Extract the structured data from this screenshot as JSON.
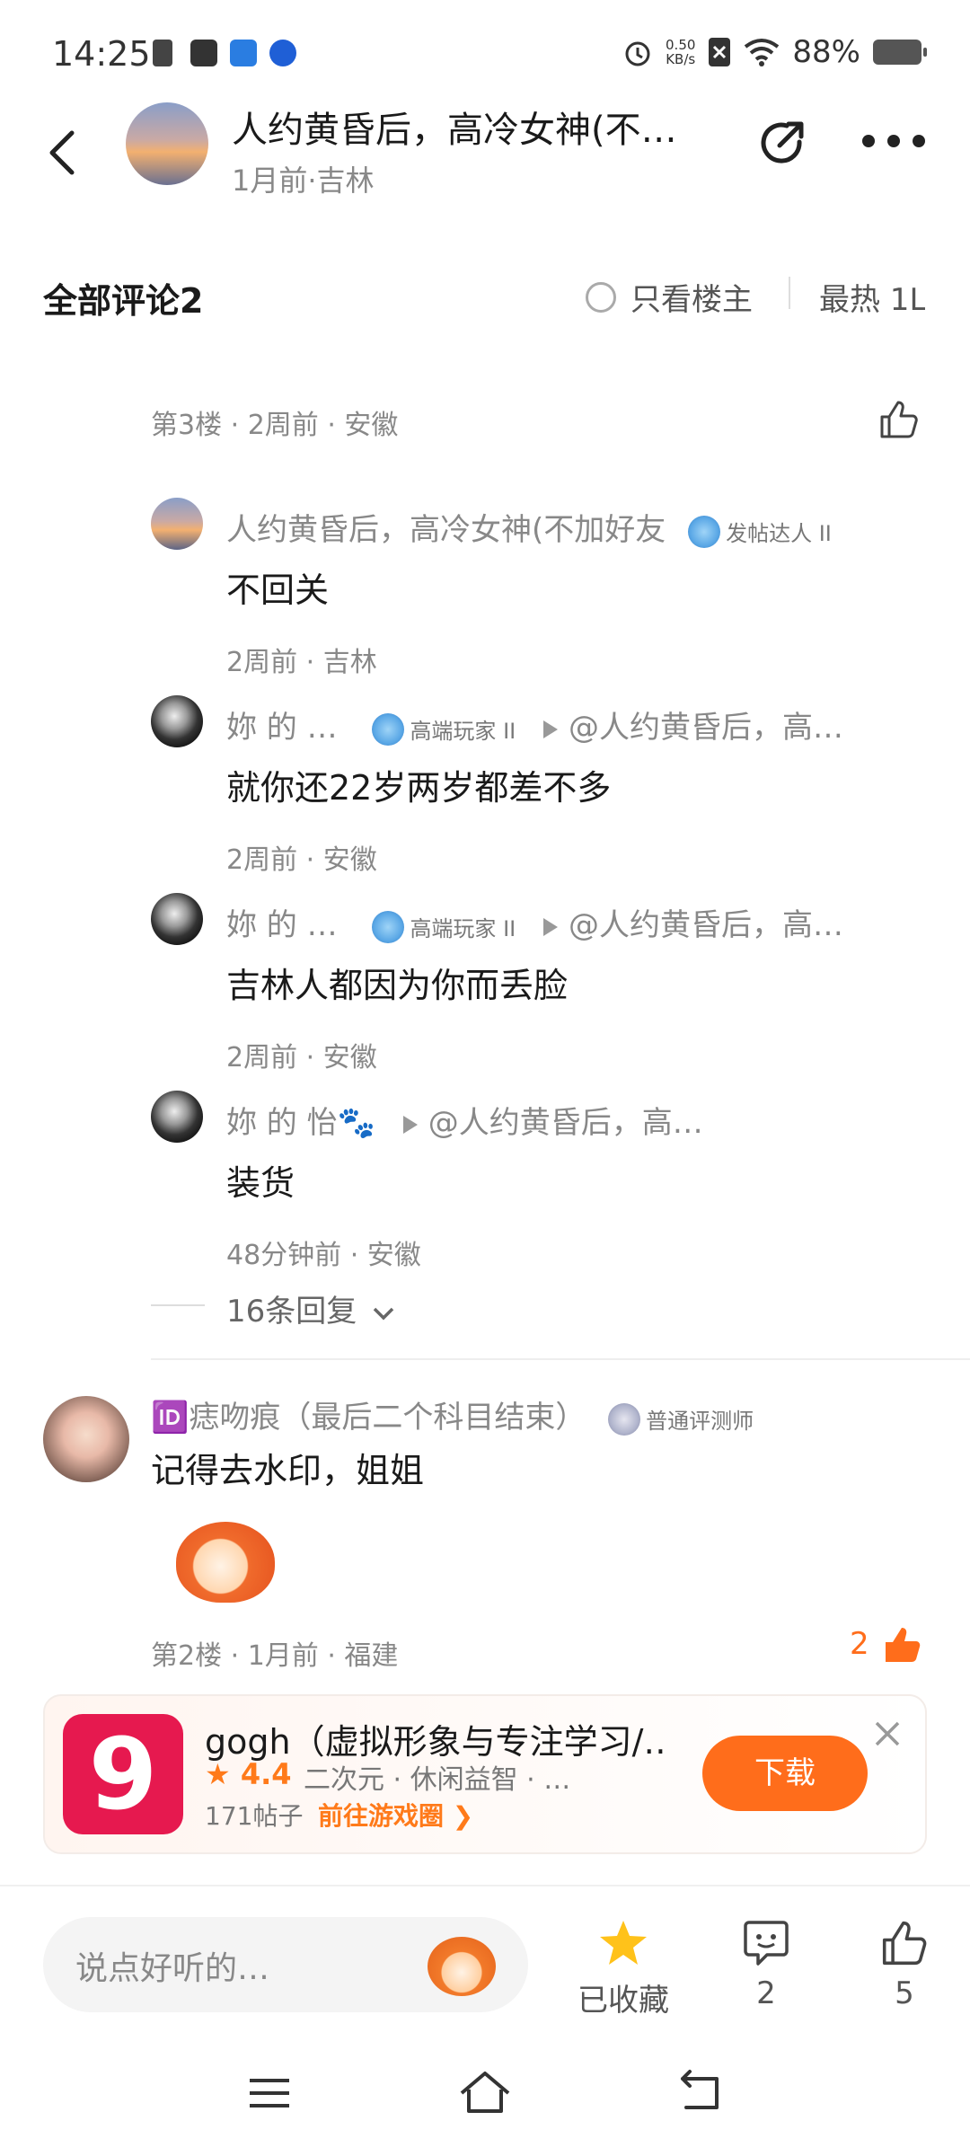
{
  "status_bar": {
    "time": "14:25",
    "speed_top": "0.50",
    "speed_bottom": "KB/s",
    "battery": "88%"
  },
  "header": {
    "title": "人约黄昏后，高冷女神(不…",
    "subtitle": "1月前·吉林"
  },
  "comments_header": {
    "title": "全部评论2",
    "op_only": "只看楼主",
    "sort": "最热 1L"
  },
  "floor3": {
    "meta": "第3楼 · 2周前 · 安徽",
    "replies": [
      {
        "name": "人约黄昏后，高冷女神(不加好友",
        "badge": "发帖达人 II",
        "reply_to": "",
        "text": "不回关",
        "meta": "2周前 · 吉林"
      },
      {
        "name": "妳 的 …",
        "badge": "高端玩家 II",
        "reply_to": "@人约黄昏后，高…",
        "text": "就你还22岁两岁都差不多",
        "meta": "2周前 · 安徽"
      },
      {
        "name": "妳 的 …",
        "badge": "高端玩家 II",
        "reply_to": "@人约黄昏后，高…",
        "text": "吉林人都因为你而丢脸",
        "meta": "2周前 · 安徽"
      },
      {
        "name": "妳 的 怡🐾",
        "badge": "",
        "reply_to": "@人约黄昏后，高…",
        "text": "装货",
        "meta": "48分钟前 · 安徽"
      }
    ],
    "more_replies": "16条回复"
  },
  "floor2": {
    "name": "🆔痣吻痕（最后二个科目结束）",
    "badge": "普通评测师",
    "text": "记得去水印，姐姐",
    "meta": "第2楼 · 1月前 · 福建",
    "likes": "2"
  },
  "ad": {
    "icon_letter": "9",
    "title": "gogh（虚拟形象与专注学习/…",
    "rating": "★ 4.4",
    "tags": "二次元  ·  休闲益智  ·  …",
    "posts": "171帖子",
    "link": "前往游戏圈 ❯",
    "button": "下载"
  },
  "bottom_bar": {
    "input_placeholder": "说点好听的…",
    "favorite_label": "已收藏",
    "comment_count": "2",
    "like_count": "5"
  },
  "colors": {
    "accent": "#ff6d1b",
    "star": "#ffc21a",
    "text_grey": "#888888"
  }
}
